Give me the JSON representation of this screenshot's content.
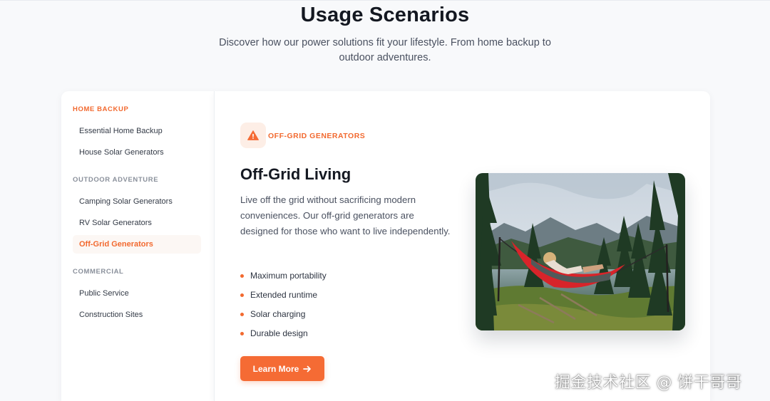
{
  "header": {
    "title": "Usage Scenarios",
    "subtitle": "Discover how our power solutions fit your lifestyle. From home backup to outdoor adventures."
  },
  "sidebar": {
    "groups": [
      {
        "title": "HOME BACKUP",
        "items": [
          "Essential Home Backup",
          "House Solar Generators"
        ]
      },
      {
        "title": "OUTDOOR ADVENTURE",
        "items": [
          "Camping Solar Generators",
          "RV Solar Generators",
          "Off-Grid Generators"
        ]
      },
      {
        "title": "COMMERCIAL",
        "items": [
          "Public Service",
          "Construction Sites"
        ]
      }
    ],
    "active_item": "Off-Grid Generators",
    "active_group": "HOME BACKUP"
  },
  "content": {
    "category_icon": "warning-triangle-icon",
    "category_label": "OFF-GRID GENERATORS",
    "title": "Off-Grid Living",
    "description": "Live off the grid without sacrificing modern conveniences. Our off-grid generators are designed for those who want to live independently.",
    "features": [
      "Maximum portability",
      "Extended runtime",
      "Solar charging",
      "Durable design"
    ],
    "cta_label": "Learn More",
    "cta_icon": "arrow-right-icon",
    "image": "person-in-hammock-forest-photo"
  },
  "watermark": "掘金技术社区 @ 饼干哥哥",
  "colors": {
    "accent": "#f56b34",
    "accent_text": "#f2692f",
    "badge_bg": "#fdeee6",
    "page_bg": "#f8f9fb"
  }
}
